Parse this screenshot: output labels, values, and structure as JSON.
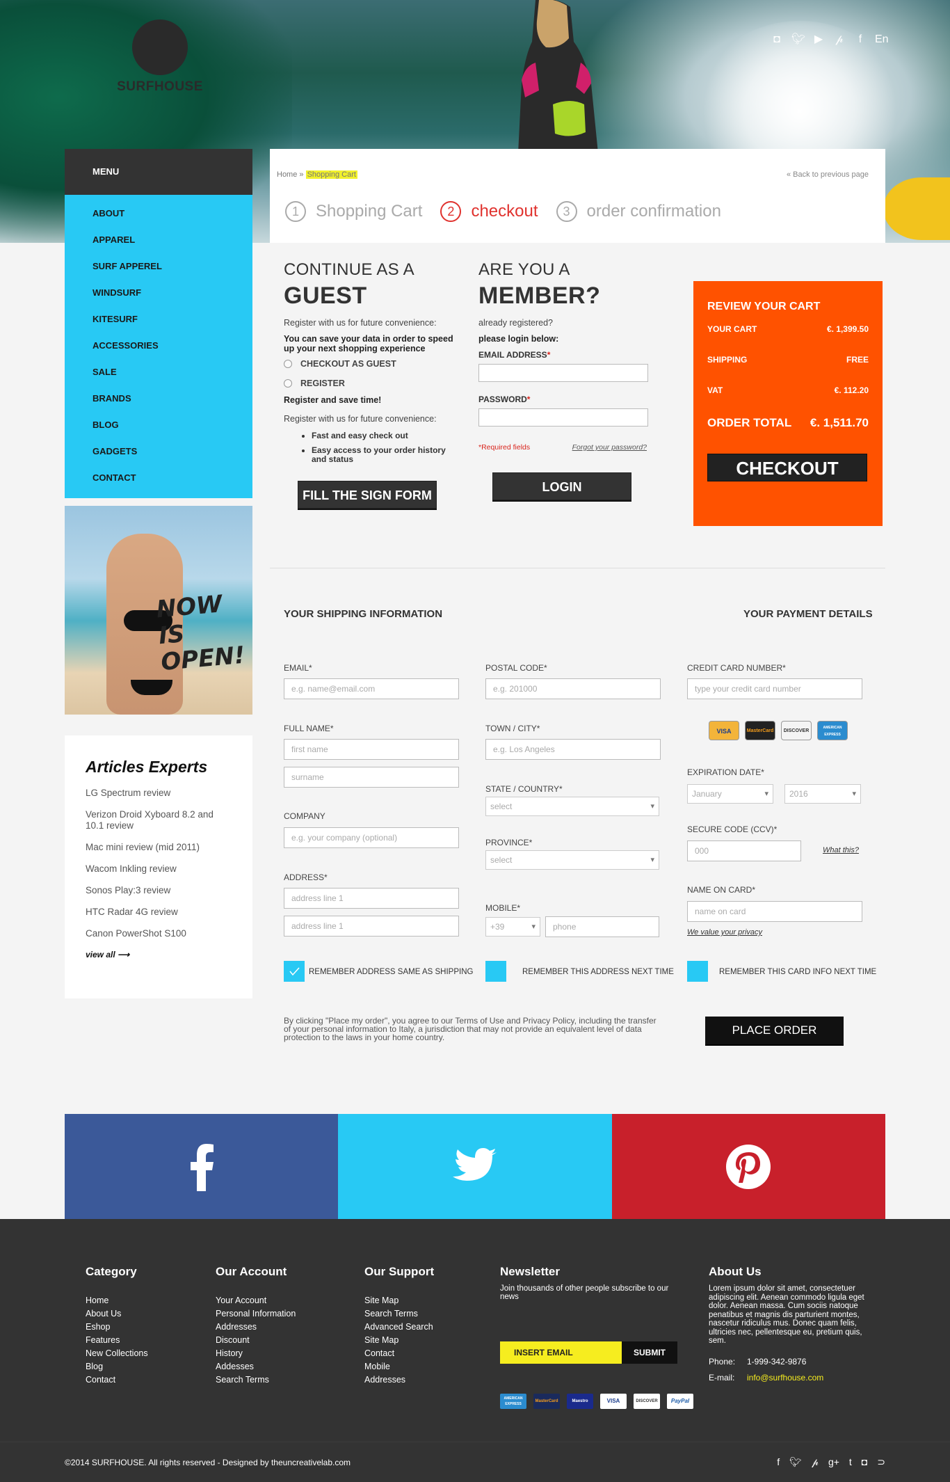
{
  "brand": {
    "name": "SURFHOUSE"
  },
  "top_social": [
    "instagram-icon",
    "twitter-icon",
    "youtube-icon",
    "pinterest-icon",
    "facebook-icon"
  ],
  "language": "En",
  "menu": {
    "title": "MENU",
    "items": [
      "ABOUT",
      "APPAREL",
      "SURF APPEREL",
      "WINDSURF",
      "KITESURF",
      "ACCESSORIES",
      "SALE",
      "BRANDS",
      "BLOG",
      "GADGETS",
      "CONTACT"
    ]
  },
  "promo": {
    "line1": "NOW",
    "line2": "IS",
    "line3": "OPEN!"
  },
  "articles": {
    "title": "Articles Experts",
    "items": [
      "LG Spectrum review",
      "Verizon Droid Xyboard 8.2 and 10.1 review",
      "Mac mini review (mid 2011)",
      "Wacom Inkling review",
      "Sonos Play:3 review",
      "HTC Radar 4G review",
      "Canon PowerShot S100"
    ],
    "view_all": "view all ⟶"
  },
  "breadcrumb": {
    "home": "Home",
    "sep": "»",
    "current": "Shopping Cart",
    "back": "« Back to previous page"
  },
  "steps": [
    {
      "num": "1",
      "label": "Shopping Cart"
    },
    {
      "num": "2",
      "label": "checkout"
    },
    {
      "num": "3",
      "label": "order confirmation"
    }
  ],
  "guest": {
    "small_title": "CONTINUE AS A",
    "big_title": "GUEST",
    "intro": "Register with us for future convenience:",
    "save_note": "You can save your data in order to speed up your next shopping experience",
    "opt1": "CHECKOUT AS GUEST",
    "opt2": "REGISTER",
    "save_time": "Register and save time!",
    "intro2": "Register with us for future convenience:",
    "bullet1": "Fast and easy check out",
    "bullet2": "Easy access to your order history and status",
    "button": "FILL THE SIGN FORM"
  },
  "member": {
    "small_title": "ARE YOU A",
    "big_title": "MEMBER?",
    "already": "already registered?",
    "please": "please login below:",
    "email_label": "EMAIL ADDRESS",
    "password_label": "PASSWORD",
    "required": "*Required fields",
    "forgot": "Forgot your password?",
    "button": "LOGIN"
  },
  "review": {
    "title": "REVIEW YOUR CART",
    "rows": [
      {
        "label": "YOUR CART",
        "value": "€. 1,399.50"
      },
      {
        "label": "SHIPPING",
        "value": "FREE"
      },
      {
        "label": "VAT",
        "value": "€. 112.20"
      }
    ],
    "total_label": "ORDER TOTAL",
    "total_value": "€. 1,511.70",
    "button": "CHECKOUT"
  },
  "shipping": {
    "title": "YOUR SHIPPING INFORMATION",
    "email_label": "EMAIL*",
    "email_ph": "e.g. name@email.com",
    "fullname_label": "FULL NAME*",
    "firstname_ph": "first name",
    "surname_ph": "surname",
    "company_label": "COMPANY",
    "company_ph": "e.g. your company (optional)",
    "address_label": "ADDRESS*",
    "address1_ph": "address line 1",
    "address2_ph": "address line 1",
    "postal_label": "POSTAL CODE*",
    "postal_ph": "e.g. 201000",
    "town_label": "TOWN / CITY*",
    "town_ph": "e.g. Los Angeles",
    "state_label": "STATE / COUNTRY*",
    "state_value": "select",
    "province_label": "PROVINCE*",
    "province_value": "select",
    "mobile_label": "MOBILE*",
    "mobile_prefix": "+39",
    "phone_ph": "phone",
    "remember1": "REMEMBER ADDRESS SAME AS SHIPPING",
    "remember2": "REMEMBER THIS ADDRESS NEXT TIME",
    "terms": "By clicking \"Place my order\", you agree to our Terms of Use and Privacy Policy, including the transfer of your personal information to Italy, a jurisdiction that may not provide an equivalent level of data protection to the laws in your home country."
  },
  "payment": {
    "title": "YOUR PAYMENT DETAILS",
    "cc_label": "CREDIT CARD NUMBER*",
    "cc_ph": "type your credit card number",
    "cards": [
      "VISA",
      "MasterCard",
      "DISCOVER",
      "AMERICAN EXPRESS"
    ],
    "exp_label": "EXPIRATION DATE*",
    "exp_month": "January",
    "exp_year": "2016",
    "ccv_label": "SECURE CODE (CCV)*",
    "ccv_ph": "000",
    "what": "What this?",
    "name_label": "NAME ON CARD*",
    "name_ph": "name on card",
    "privacy": "We value your privacy",
    "remember3": "REMEMBER THIS CARD INFO NEXT TIME",
    "place_order": "PLACE ORDER"
  },
  "colors": {
    "cyan": "#28c9f4",
    "orange": "#ff5200",
    "facebook": "#3b5999",
    "twitter": "#28c9f4",
    "pinterest": "#c8202b"
  },
  "footer": {
    "category": {
      "title": "Category",
      "links": [
        "Home",
        "About Us",
        "Eshop",
        "Features",
        "New Collections",
        "Blog",
        "Contact"
      ]
    },
    "account": {
      "title": "Our Account",
      "links": [
        "Your Account",
        "Personal Information",
        "Addresses",
        "Discount",
        "History",
        "Addesses",
        "Search Terms"
      ]
    },
    "support": {
      "title": "Our Support",
      "links": [
        "Site Map",
        "Search Terms",
        "Advanced Search",
        "Site Map",
        "Contact",
        "Mobile",
        "Addresses"
      ]
    },
    "newsletter": {
      "title": "Newsletter",
      "text": "Join thousands of other people subscribe to our news",
      "placeholder": "INSERT EMAIL",
      "button": "SUBMIT",
      "payments": [
        "AMERICAN EXPRESS",
        "MasterCard",
        "Maestro",
        "VISA",
        "DISCOVER",
        "PayPal"
      ]
    },
    "about": {
      "title": "About Us",
      "text": "Lorem ipsum dolor sit amet, consectetuer adipiscing elit. Aenean commodo ligula eget dolor. Aenean massa. Cum sociis natoque penatibus et magnis dis parturient montes, nascetur ridiculus mus. Donec quam felis, ultricies nec, pellentesque eu, pretium quis, sem.",
      "phone_label": "Phone:",
      "phone": "1-999-342-9876",
      "email_label": "E-mail:",
      "email": "info@surfhouse.com"
    }
  },
  "copyright": "©2014 SURFHOUSE. All rights reserved - Designed by theuncreativelab.com"
}
